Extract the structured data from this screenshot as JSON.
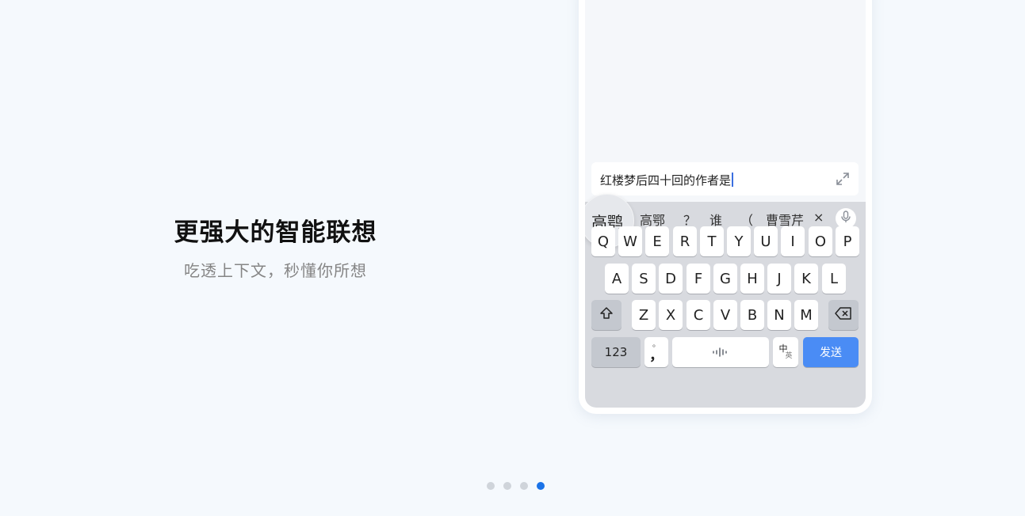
{
  "slide": {
    "title": "更强大的智能联想",
    "subtitle": "吃透上下文，秒懂你所想"
  },
  "input": {
    "text": "红楼梦后四十回的作者是",
    "expand_icon": "expand-icon"
  },
  "candidates": [
    "高鹗",
    "高鄂",
    "？",
    "谁",
    "（",
    "曹雪芹"
  ],
  "candidate_controls": {
    "close_label": "×",
    "mic_icon": "mic-icon"
  },
  "keyboard": {
    "row1": [
      "Q",
      "W",
      "E",
      "R",
      "T",
      "Y",
      "U",
      "I",
      "O",
      "P"
    ],
    "row2": [
      "A",
      "S",
      "D",
      "F",
      "G",
      "H",
      "J",
      "K",
      "L"
    ],
    "row3": [
      "Z",
      "X",
      "C",
      "V",
      "B",
      "N",
      "M"
    ],
    "shift_icon": "shift-icon",
    "backspace_icon": "backspace-icon",
    "numbers_label": "123",
    "punct_top": "。",
    "punct_bottom": "，",
    "space_icon": "voice-wave-icon",
    "lang_top": "中",
    "lang_bottom": "英",
    "send_label": "发送"
  },
  "pager": {
    "total": 4,
    "active": 4
  },
  "colors": {
    "background": "#f5f9fd",
    "accent": "#1a73e8",
    "send_key": "#4a8cf5"
  }
}
